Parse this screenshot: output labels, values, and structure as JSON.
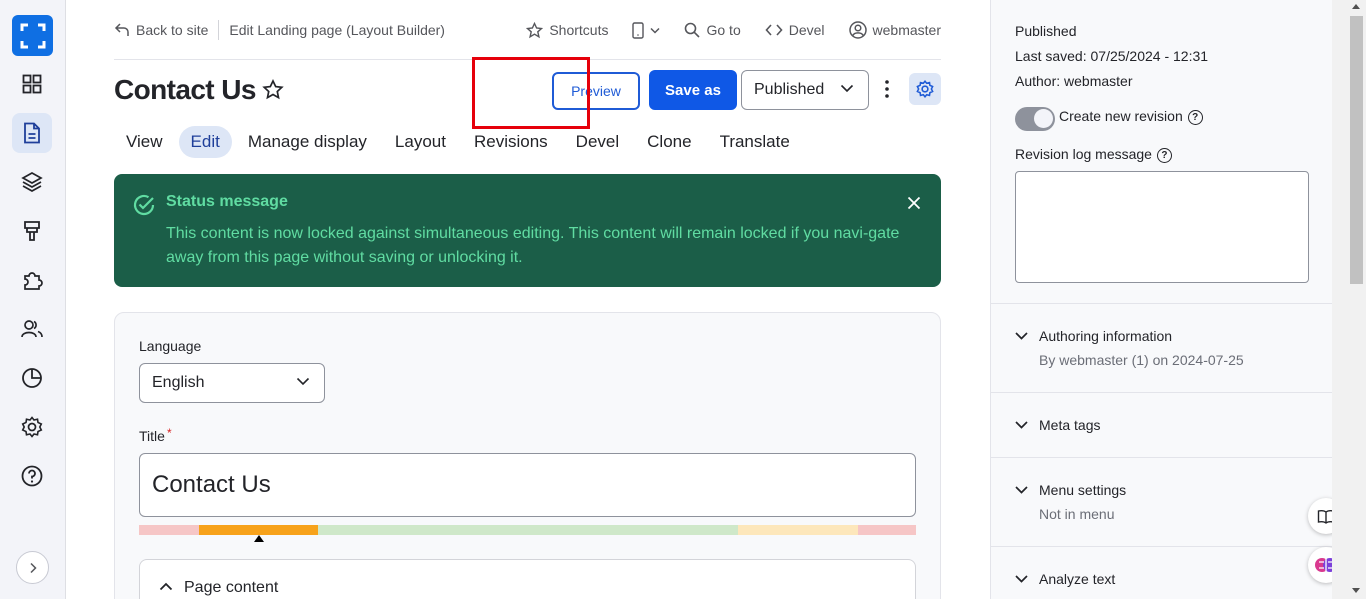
{
  "topbar": {
    "back_label": "Back to site",
    "breadcrumb": "Edit Landing page (Layout Builder)",
    "shortcuts": "Shortcuts",
    "goto": "Go to",
    "devel": "Devel",
    "user": "webmaster"
  },
  "page": {
    "title": "Contact Us",
    "preview_label": "Preview",
    "save_label": "Save as",
    "state_value": "Published"
  },
  "tabs": [
    {
      "label": "View"
    },
    {
      "label": "Edit",
      "active": true
    },
    {
      "label": "Manage display"
    },
    {
      "label": "Layout"
    },
    {
      "label": "Revisions"
    },
    {
      "label": "Devel"
    },
    {
      "label": "Clone"
    },
    {
      "label": "Translate"
    }
  ],
  "status": {
    "title": "Status message",
    "text": "This content is now locked against simultaneous editing. This content will remain locked if you navi-gate away from this page without saving or unlocking it."
  },
  "form": {
    "language_label": "Language",
    "language_value": "English",
    "title_label": "Title",
    "required_mark": "*",
    "title_value": "Contact Us",
    "section_label": "Page content"
  },
  "sidebar": {
    "status": "Published",
    "last_saved_label": "Last saved:",
    "last_saved_value": "07/25/2024 - 12:31",
    "author_label": "Author:",
    "author_value": "webmaster",
    "new_revision_label": "Create new revision",
    "revision_log_label": "Revision log message",
    "sections": [
      {
        "title": "Authoring information",
        "sub": "By webmaster (1) on 2024-07-25"
      },
      {
        "title": "Meta tags",
        "sub": ""
      },
      {
        "title": "Menu settings",
        "sub": "Not in menu"
      },
      {
        "title": "Analyze text",
        "sub": ""
      }
    ]
  },
  "colors": {
    "accent": "#0f58e6",
    "status_bg": "#1b5e48",
    "status_text": "#60dca2",
    "highlight": "#e6000b"
  },
  "score_segments": [
    {
      "color": "#f6c6c6",
      "fraction": 0.077
    },
    {
      "color": "#f7a21b",
      "fraction": 0.154
    },
    {
      "color": "#cfe8c9",
      "fraction": 0.54
    },
    {
      "color": "#fde7bb",
      "fraction": 0.154
    },
    {
      "color": "#f6c6c6",
      "fraction": 0.075
    }
  ]
}
